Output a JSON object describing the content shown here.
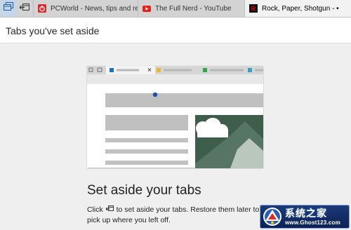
{
  "tabs": [
    {
      "title": "PCWorld - News, tips and re",
      "favicon": "pcworld-favicon"
    },
    {
      "title": "The Full Nerd - YouTube",
      "favicon": "youtube-favicon"
    },
    {
      "title": "Rock, Paper, Shotgun - •",
      "favicon": "rps-favicon"
    }
  ],
  "strip_buttons": {
    "tabs_aside_icon": "tabs-aside-icon",
    "set_aside_icon": "set-aside-icon"
  },
  "panel": {
    "title": "Tabs you've set aside"
  },
  "empty_state": {
    "headline": "Set aside your tabs",
    "text_before": "Click",
    "icon": "set-aside-icon",
    "text_after": "to set aside your tabs. Restore them later to pick up where you left off."
  },
  "watermark": {
    "title": "系统之家",
    "url": "www.Ghost123.com"
  },
  "colors": {
    "tabstrip": "#d3d3d3",
    "active_tab": "#f2f2f2",
    "page_bg": "#efefef",
    "pcworld_red": "#d42b2b",
    "youtube_red": "#e62117",
    "rps_red": "#c40000",
    "accent_blue": "#1b72c9"
  }
}
